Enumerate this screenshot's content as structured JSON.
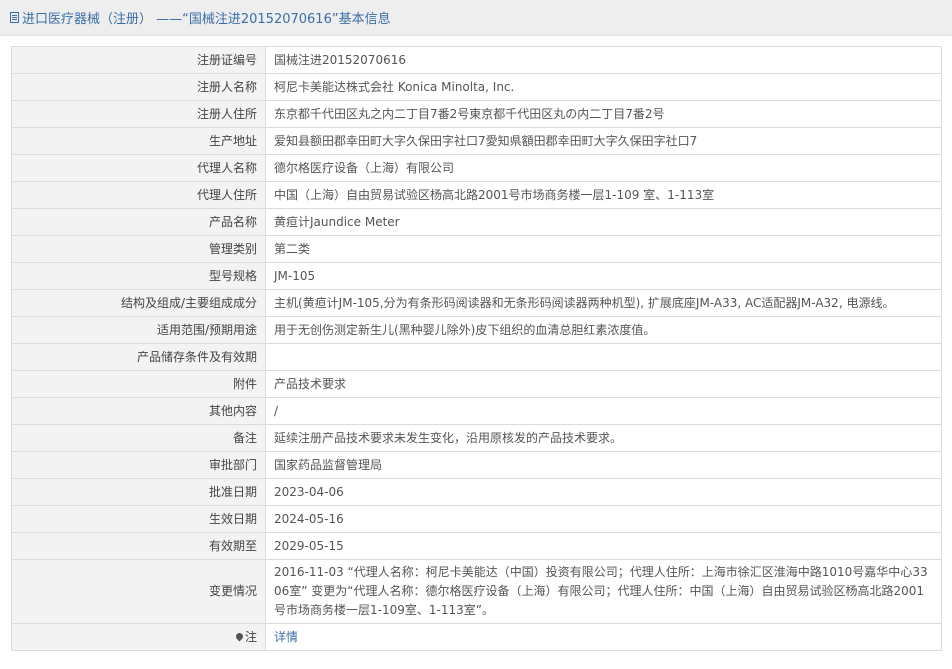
{
  "header": {
    "title": "进口医疗器械（注册） ——“国械注进20152070616”基本信息",
    "icon": "document-icon"
  },
  "rows": [
    {
      "label": "注册证编号",
      "value": "国械注进20152070616"
    },
    {
      "label": "注册人名称",
      "value": "柯尼卡美能达株式会社 Konica Minolta, Inc."
    },
    {
      "label": "注册人住所",
      "value": "东京都千代田区丸之内二丁目7番2号東京都千代田区丸の内二丁目7番2号"
    },
    {
      "label": "生产地址",
      "value": "爱知县额田郡幸田町大字久保田字社口7愛知県額田郡幸田町大字久保田字社口7"
    },
    {
      "label": "代理人名称",
      "value": "德尔格医疗设备（上海）有限公司"
    },
    {
      "label": "代理人住所",
      "value": "中国（上海）自由贸易试验区杨高北路2001号市场商务楼一层1-109 室、1-113室"
    },
    {
      "label": "产品名称",
      "value": "黄疸计Jaundice Meter"
    },
    {
      "label": "管理类别",
      "value": "第二类"
    },
    {
      "label": "型号规格",
      "value": "JM-105"
    },
    {
      "label": "结构及组成/主要组成成分",
      "value": "主机(黄疸计JM-105,分为有条形码阅读器和无条形码阅读器两种机型), 扩展底座JM-A33, AC适配器JM-A32, 电源线。"
    },
    {
      "label": "适用范围/预期用途",
      "value": "用于无创伤测定新生儿(黑种婴儿除外)皮下组织的血清总胆红素浓度值。"
    },
    {
      "label": "产品储存条件及有效期",
      "value": ""
    },
    {
      "label": "附件",
      "value": "产品技术要求"
    },
    {
      "label": "其他内容",
      "value": "/"
    },
    {
      "label": "备注",
      "value": "延续注册产品技术要求未发生变化，沿用原核发的产品技术要求。"
    },
    {
      "label": "审批部门",
      "value": "国家药品监督管理局"
    },
    {
      "label": "批准日期",
      "value": "2023-04-06"
    },
    {
      "label": "生效日期",
      "value": "2024-05-16"
    },
    {
      "label": "有效期至",
      "value": "2029-05-15"
    },
    {
      "label": "变更情况",
      "value": "2016-11-03 “代理人名称：柯尼卡美能达（中国）投资有限公司；代理人住所：上海市徐汇区淮海中路1010号嘉华中心3306室” 变更为“代理人名称：德尔格医疗设备（上海）有限公司；代理人住所：中国（上海）自由贸易试验区杨高北路2001号市场商务楼一层1-109室、1-113室”。"
    }
  ],
  "note_row": {
    "label": "注",
    "icon": "location-pin-icon",
    "link_text": "详情"
  },
  "colors": {
    "accent": "#3b6ea8",
    "label_bg": "#f3f3f3",
    "border": "#dcdcdc"
  }
}
